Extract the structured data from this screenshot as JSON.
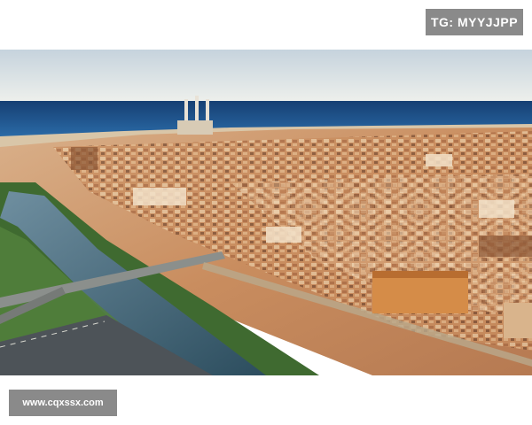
{
  "watermark_top": "TG: MYYJJPP",
  "watermark_bottom": "www.cqxssx.com",
  "photo": {
    "subject": "aerial-coastal-city",
    "colors": {
      "sky_top": "#c9d5de",
      "sky_bottom": "#eef0ee",
      "sea": "#1f5f9c",
      "sea_dark": "#163f73",
      "city_warm": "#c8885a",
      "city_light": "#e6c7a5",
      "greenery": "#4f7a3a",
      "river": "#2f5a6e"
    }
  }
}
